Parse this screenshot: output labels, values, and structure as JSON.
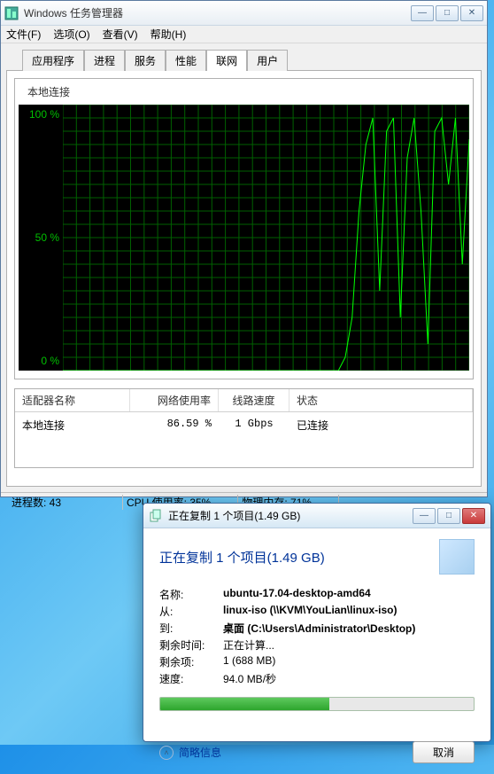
{
  "taskmgr": {
    "title": "Windows 任务管理器",
    "menu": {
      "file": "文件(F)",
      "options": "选项(O)",
      "view": "查看(V)",
      "help": "帮助(H)"
    },
    "tabs": {
      "apps": "应用程序",
      "processes": "进程",
      "services": "服务",
      "performance": "性能",
      "networking": "联网",
      "users": "用户"
    },
    "chart_title": "本地连接",
    "y_labels": {
      "top": "100 %",
      "mid": "50 %",
      "bot": "0 %"
    },
    "table": {
      "headers": {
        "adapter": "适配器名称",
        "usage": "网络使用率",
        "speed": "线路速度",
        "state": "状态"
      },
      "row": {
        "adapter": "本地连接",
        "usage": "86.59 %",
        "speed": "1 Gbps",
        "state": "已连接"
      }
    },
    "status": {
      "processes": "进程数: 43",
      "cpu": "CPU 使用率: 35%",
      "mem": "物理内存: 71%"
    }
  },
  "copy": {
    "titlebar": "正在复制 1 个项目(1.49 GB)",
    "heading": "正在复制 1 个项目(1.49 GB)",
    "labels": {
      "name": "名称:",
      "from": "从:",
      "to": "到:",
      "time_left": "剩余时间:",
      "items_left": "剩余项:",
      "speed": "速度:"
    },
    "values": {
      "name": "ubuntu-17.04-desktop-amd64",
      "from": "linux-iso (\\\\KVM\\YouLian\\linux-iso)",
      "to": "桌面 (C:\\Users\\Administrator\\Desktop)",
      "time_left": "正在计算...",
      "items_left": "1 (688 MB)",
      "speed": "94.0 MB/秒"
    },
    "progress_percent": 54,
    "more": "简略信息",
    "cancel": "取消"
  },
  "chart_data": {
    "type": "line",
    "title": "本地连接 网络使用率",
    "ylabel": "%",
    "ylim": [
      0,
      100
    ],
    "x": [
      0,
      1,
      2,
      3,
      4,
      5,
      6,
      7,
      8,
      9,
      10,
      11,
      12,
      13,
      14,
      15,
      16,
      17,
      18,
      19,
      20,
      21,
      22,
      23,
      24,
      25,
      26,
      27,
      28,
      29,
      30,
      31,
      32,
      33,
      34,
      35,
      36,
      37,
      38,
      39,
      40,
      41,
      42,
      43,
      44,
      45,
      46,
      47,
      48,
      49,
      50,
      51,
      52,
      53,
      54,
      55,
      56,
      57,
      58,
      59
    ],
    "values": [
      0,
      0,
      0,
      0,
      0,
      0,
      0,
      0,
      0,
      0,
      0,
      0,
      0,
      0,
      0,
      0,
      0,
      0,
      0,
      0,
      0,
      0,
      0,
      0,
      0,
      0,
      0,
      0,
      0,
      0,
      0,
      0,
      0,
      0,
      0,
      0,
      0,
      0,
      0,
      0,
      0,
      5,
      20,
      60,
      85,
      95,
      30,
      90,
      95,
      20,
      80,
      95,
      60,
      10,
      90,
      95,
      70,
      95,
      40,
      87
    ]
  }
}
